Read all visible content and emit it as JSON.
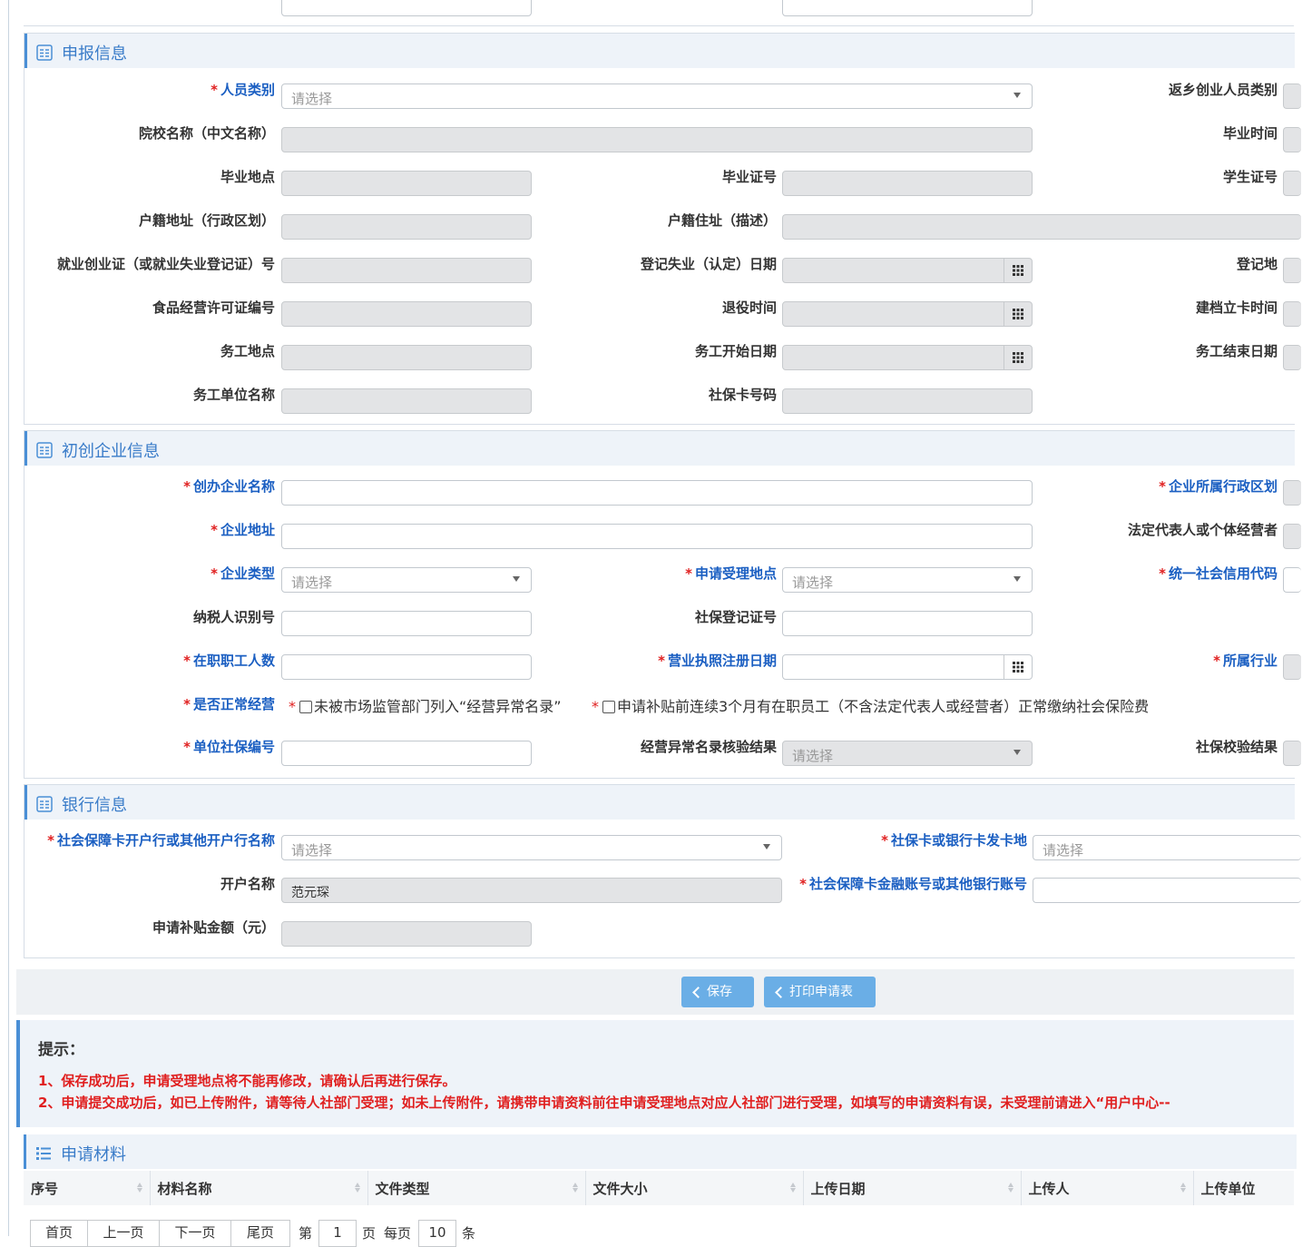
{
  "top_fields": {},
  "sections": {
    "report": {
      "title": "申报信息",
      "labels": {
        "person_category": "人员类别",
        "return_category": "返乡创业人员类别",
        "school_name": "院校名称（中文名称）",
        "grad_time": "毕业时间",
        "grad_place": "毕业地点",
        "grad_cert": "毕业证号",
        "student_id": "学生证号",
        "household_addr": "户籍地址（行政区划）",
        "household_residence": "户籍住址（描述）",
        "employment_cert": "就业创业证（或就业失业登记证）号",
        "unemp_date": "登记失业（认定）日期",
        "reg_place": "登记地",
        "food_license": "食品经营许可证编号",
        "retire_time": "退役时间",
        "file_time": "建档立卡时间",
        "work_place": "务工地点",
        "work_start": "务工开始日期",
        "work_end": "务工结束日期",
        "work_unit": "务工单位名称",
        "ss_card": "社保卡号码"
      },
      "person_category_placeholder": "请选择"
    },
    "enterprise": {
      "title": "初创企业信息",
      "labels": {
        "name": "创办企业名称",
        "region": "企业所属行政区划",
        "address": "企业地址",
        "legal_rep": "法定代表人或个体经营者",
        "type": "企业类型",
        "accept_place": "申请受理地点",
        "credit_code": "统一社会信用代码",
        "tax_id": "纳税人识别号",
        "ss_reg": "社保登记证号",
        "employees": "在职职工人数",
        "license_date": "营业执照注册日期",
        "industry": "所属行业",
        "normal_op": "是否正常经营",
        "unit_ss": "单位社保编号",
        "abnormal_check": "经营异常名录核验结果",
        "ss_check": "社保校验结果"
      },
      "type_placeholder": "请选择",
      "accept_placeholder": "请选择",
      "abnormal_placeholder": "请选择",
      "check1": "未被市场监管部门列入“经营异常名录”",
      "check2": "申请补贴前连续3个月有在职员工（不含法定代表人或经营者）正常缴纳社会保险费"
    },
    "bank": {
      "title": "银行信息",
      "labels": {
        "bank_name": "社会保障卡开户行或其他开户行名称",
        "card_place": "社保卡或银行卡发卡地",
        "account_name": "开户名称",
        "account_no": "社会保障卡金融账号或其他银行账号",
        "amount": "申请补贴金额（元）"
      },
      "bank_placeholder": "请选择",
      "card_place_placeholder": "请选择",
      "account_name_value": "范元琛"
    }
  },
  "buttons": {
    "save": "保存",
    "print": "打印申请表"
  },
  "tips": {
    "title": "提示：",
    "line1": "1、保存成功后，申请受理地点将不能再修改，请确认后再进行保存。",
    "line2": "2、申请提交成功后，如已上传附件，请等待人社部门受理；如未上传附件，请携带申请资料前往申请受理地点对应人社部门进行受理，如填写的申请资料有误，未受理前请进入“用户中心--"
  },
  "materials": {
    "title": "申请材料",
    "columns": [
      "序号",
      "材料名称",
      "文件类型",
      "文件大小",
      "上传日期",
      "上传人",
      "上传单位"
    ]
  },
  "pager": {
    "first": "首页",
    "prev": "上一页",
    "next": "下一页",
    "last": "尾页",
    "page_prefix": "第",
    "page_value": "1",
    "page_suffix": "页",
    "per_page_prefix": "每页",
    "per_page_value": "10",
    "per_page_suffix": "条"
  },
  "colors": {
    "accent": "#3a7cc9",
    "required_label": "#1b5fc2",
    "star": "#e02020",
    "button": "#6aaee6"
  }
}
